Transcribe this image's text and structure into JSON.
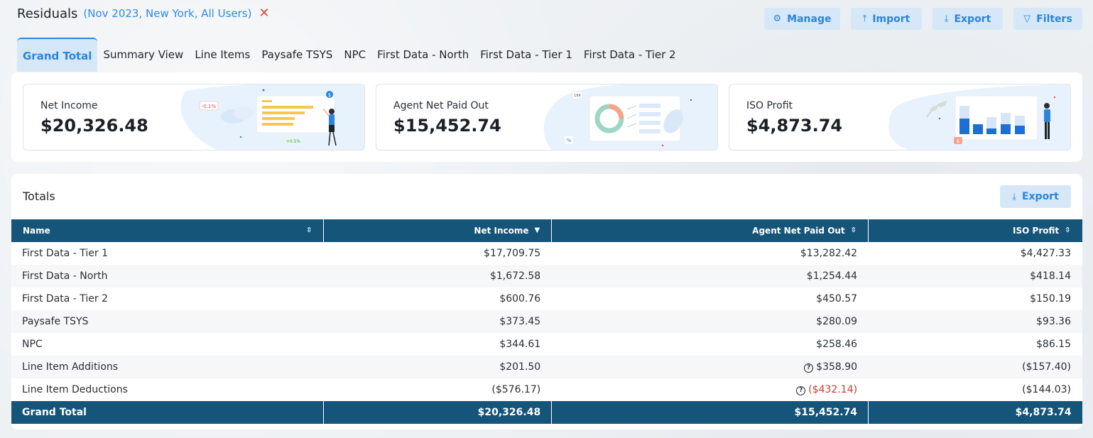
{
  "header": {
    "title": "Residuals",
    "filter_description": "(Nov 2023, New York, All Users)",
    "clear_icon": "close-icon"
  },
  "actions": {
    "manage_label": "Manage",
    "manage_icon": "gear-icon",
    "import_label": "Import",
    "import_icon": "upload-icon",
    "export_label": "Export",
    "export_icon": "download-icon",
    "filters_label": "Filters",
    "filters_icon": "funnel-icon"
  },
  "tabs": [
    {
      "label": "Grand Total",
      "active": true
    },
    {
      "label": "Summary View",
      "active": false
    },
    {
      "label": "Line Items",
      "active": false
    },
    {
      "label": "Paysafe TSYS",
      "active": false
    },
    {
      "label": "NPC",
      "active": false
    },
    {
      "label": "First Data - North",
      "active": false
    },
    {
      "label": "First Data - Tier 1",
      "active": false
    },
    {
      "label": "First Data - Tier 2",
      "active": false
    }
  ],
  "cards": [
    {
      "label": "Net Income",
      "value": "$20,326.48",
      "illus_tags": [
        "-0.1%",
        "+0.5%",
        "$"
      ]
    },
    {
      "label": "Agent Net Paid Out",
      "value": "$15,452.74",
      "illus_tags": [
        "16K",
        "%"
      ]
    },
    {
      "label": "ISO Profit",
      "value": "$4,873.74",
      "illus_tags": [
        "$"
      ]
    }
  ],
  "totals": {
    "title": "Totals",
    "export_label": "Export",
    "columns": [
      {
        "label": "Name",
        "sort": "both"
      },
      {
        "label": "Net Income",
        "sort": "desc"
      },
      {
        "label": "Agent Net Paid Out",
        "sort": "both"
      },
      {
        "label": "ISO Profit",
        "sort": "both"
      }
    ],
    "rows": [
      {
        "name": "First Data - Tier 1",
        "net_income": "$17,709.75",
        "agent_net_paid_out": "$13,282.42",
        "iso_profit": "$4,427.33"
      },
      {
        "name": "First Data - North",
        "net_income": "$1,672.58",
        "agent_net_paid_out": "$1,254.44",
        "iso_profit": "$418.14"
      },
      {
        "name": "First Data - Tier 2",
        "net_income": "$600.76",
        "agent_net_paid_out": "$450.57",
        "iso_profit": "$150.19"
      },
      {
        "name": "Paysafe TSYS",
        "net_income": "$373.45",
        "agent_net_paid_out": "$280.09",
        "iso_profit": "$93.36"
      },
      {
        "name": "NPC",
        "net_income": "$344.61",
        "agent_net_paid_out": "$258.46",
        "iso_profit": "$86.15"
      },
      {
        "name": "Line Item Additions",
        "net_income": "$201.50",
        "agent_net_paid_out": "$358.90",
        "agent_help": true,
        "iso_profit": "($157.40)"
      },
      {
        "name": "Line Item Deductions",
        "net_income": "($576.17)",
        "agent_net_paid_out": "($432.14)",
        "agent_help": true,
        "iso_profit": "($144.03)"
      }
    ],
    "footer": {
      "name": "Grand Total",
      "net_income": "$20,326.48",
      "agent_net_paid_out": "$15,452.74",
      "iso_profit": "$4,873.74"
    }
  },
  "colors": {
    "accent": "#2a85dc",
    "header_bg": "#16557a",
    "negative": "#cc3a32",
    "button_bg": "#d6e8f8"
  }
}
